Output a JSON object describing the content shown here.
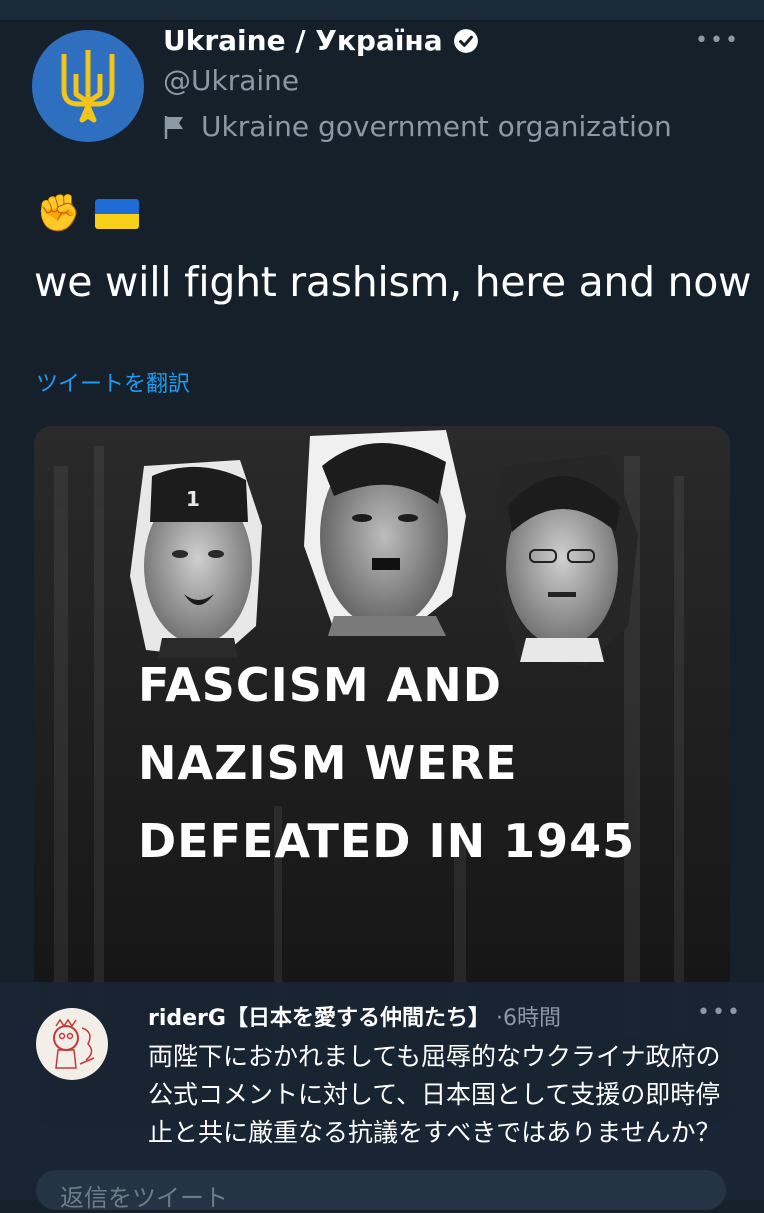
{
  "account": {
    "display_name": "Ukraine / Україна",
    "handle": "@Ukraine",
    "affiliation": "Ukraine government organization"
  },
  "tweet": {
    "emojis": [
      "✊",
      "🇺🇦"
    ],
    "text": "we will fight rashism, here and now",
    "translate_link": "ツイートを翻訳"
  },
  "media": {
    "headline_lines": [
      "FASCISM AND",
      "NAZISM WERE",
      "DEFEATED IN 1945"
    ]
  },
  "reply": {
    "username": "riderG【日本を愛する仲間たち】",
    "time": "·6時間",
    "text": "両陛下におかれましても屈辱的なウクライナ政府の公式コメントに対して、日本国として支援の即時停止と共に厳重なる抗議をすべきではありませんか？",
    "input_placeholder": "返信をツイート"
  },
  "colors": {
    "background": "#15202b",
    "accent": "#1d9bf0",
    "secondary_text": "#8b98a5",
    "avatar_blue": "#2f6fc0",
    "trident_gold": "#f2c51a"
  },
  "icons": {
    "more": "more-horizontal-icon",
    "verified": "verified-badge-icon",
    "affiliation": "flag-icon",
    "avatar": "tryzub-coat-of-arms-icon"
  }
}
